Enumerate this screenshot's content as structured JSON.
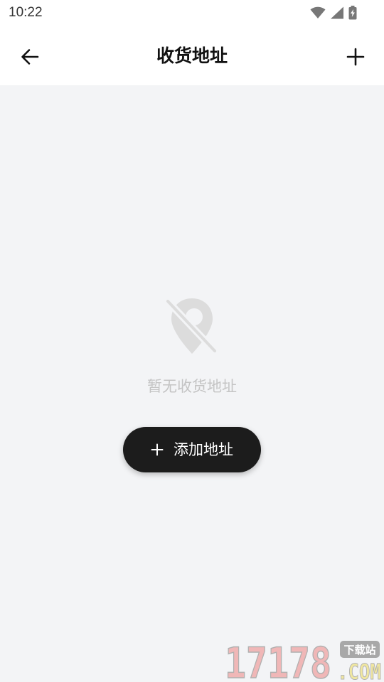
{
  "status_bar": {
    "time": "10:22",
    "icons": [
      "wifi-icon",
      "signal-icon",
      "battery-charging-icon"
    ]
  },
  "header": {
    "title": "收货地址",
    "back_icon": "arrow-left-icon",
    "add_icon": "plus-icon"
  },
  "empty_state": {
    "icon": "location-off-icon",
    "message": "暂无收货地址"
  },
  "add_button": {
    "icon": "plus-icon",
    "label": "添加地址"
  },
  "watermark": {
    "number": "17178",
    "suffix": ".COM",
    "badge": "下载站"
  },
  "colors": {
    "background": "#f3f4f6",
    "header": "#ffffff",
    "button": "#1c1c1c",
    "empty_text": "#c4c4c4",
    "empty_icon": "#dcdcdc"
  }
}
